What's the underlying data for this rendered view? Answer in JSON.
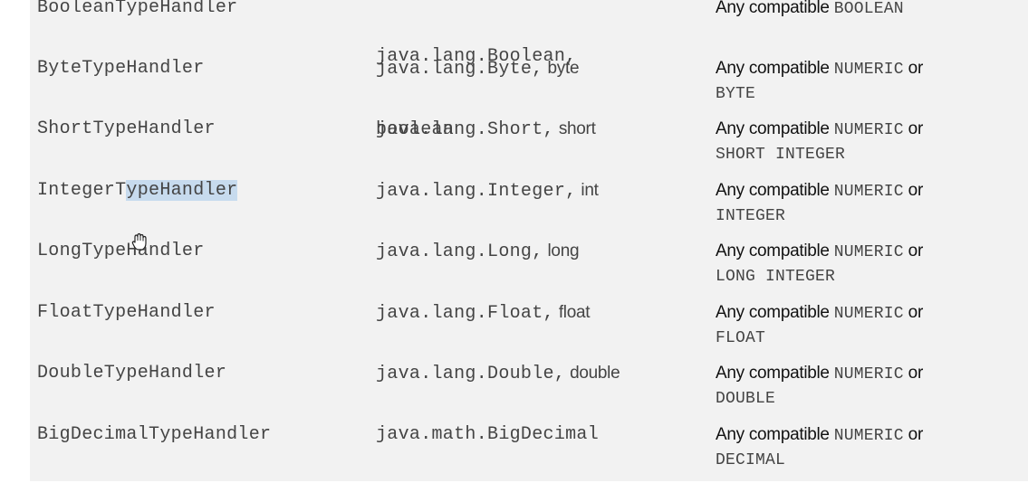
{
  "rows": [
    {
      "handler": "BooleanTypeHandler",
      "java_type_1": "java.lang.Boolean,",
      "java_type_2": "boolean",
      "sql_prefix": "Any compatible ",
      "sql_type_1": "BOOLEAN",
      "sql_suffix": "",
      "sql_type_2": ""
    },
    {
      "handler": "ByteTypeHandler",
      "java_type": "java.lang.Byte,",
      "java_primitive": " byte",
      "sql_prefix": "Any compatible ",
      "sql_type_1": "NUMERIC",
      "sql_suffix": " or",
      "sql_type_2": "BYTE"
    },
    {
      "handler": "ShortTypeHandler",
      "java_type": "java.lang.Short,",
      "java_primitive": " short",
      "sql_prefix": "Any compatible ",
      "sql_type_1": "NUMERIC",
      "sql_suffix": " or",
      "sql_type_2": "SHORT INTEGER"
    },
    {
      "handler_start": "IntegerT",
      "handler_selected": "ypeHandler",
      "java_type": "java.lang.Integer,",
      "java_primitive": " int",
      "sql_prefix": "Any compatible ",
      "sql_type_1": "NUMERIC",
      "sql_suffix": " or",
      "sql_type_2": "INTEGER"
    },
    {
      "handler": "LongTypeHandler",
      "java_type": "java.lang.Long,",
      "java_primitive": " long",
      "sql_prefix": "Any compatible ",
      "sql_type_1": "NUMERIC",
      "sql_suffix": " or",
      "sql_type_2": "LONG INTEGER"
    },
    {
      "handler": "FloatTypeHandler",
      "java_type": "java.lang.Float,",
      "java_primitive": " float",
      "sql_prefix": "Any compatible ",
      "sql_type_1": "NUMERIC",
      "sql_suffix": " or",
      "sql_type_2": "FLOAT"
    },
    {
      "handler": "DoubleTypeHandler",
      "java_type": "java.lang.Double,",
      "java_primitive": " double",
      "sql_prefix": "Any compatible ",
      "sql_type_1": "NUMERIC",
      "sql_suffix": " or",
      "sql_type_2": "DOUBLE"
    },
    {
      "handler": "BigDecimalTypeHandler",
      "java_type": "java.math.BigDecimal",
      "java_primitive": "",
      "sql_prefix": "Any compatible ",
      "sql_type_1": "NUMERIC",
      "sql_suffix": " or",
      "sql_type_2": "DECIMAL"
    }
  ],
  "colors": {
    "panel_background": "#f2f2f2",
    "selection_highlight": "#c7dbee",
    "mono_text": "#444444",
    "sans_text": "#111111"
  },
  "icons": {
    "cursor": "grab-hand-cursor-icon"
  }
}
